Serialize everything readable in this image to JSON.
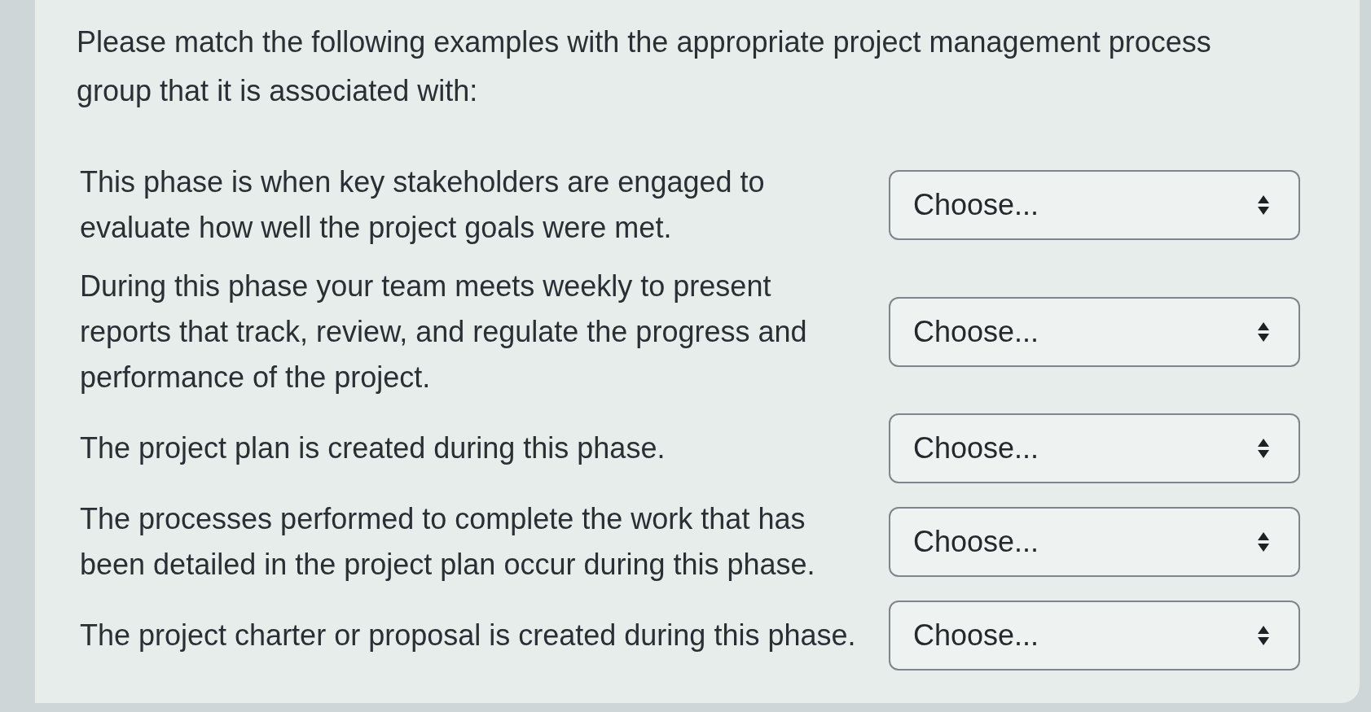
{
  "prompt": "Please match the following examples with the appropriate project management process group that it is associated with:",
  "items": [
    {
      "statement": "This phase is when key stakeholders are engaged to evaluate how well the project goals were met.",
      "selection": "Choose..."
    },
    {
      "statement": "During this phase your team meets weekly to present reports that track, review, and regulate the progress and performance of the project.",
      "selection": "Choose..."
    },
    {
      "statement": "The project plan is created during this phase.",
      "selection": "Choose..."
    },
    {
      "statement": "The processes performed to complete the work that has been detailed in the project plan occur during this phase.",
      "selection": "Choose..."
    },
    {
      "statement": "The project charter or proposal is created during this phase.",
      "selection": "Choose..."
    }
  ]
}
